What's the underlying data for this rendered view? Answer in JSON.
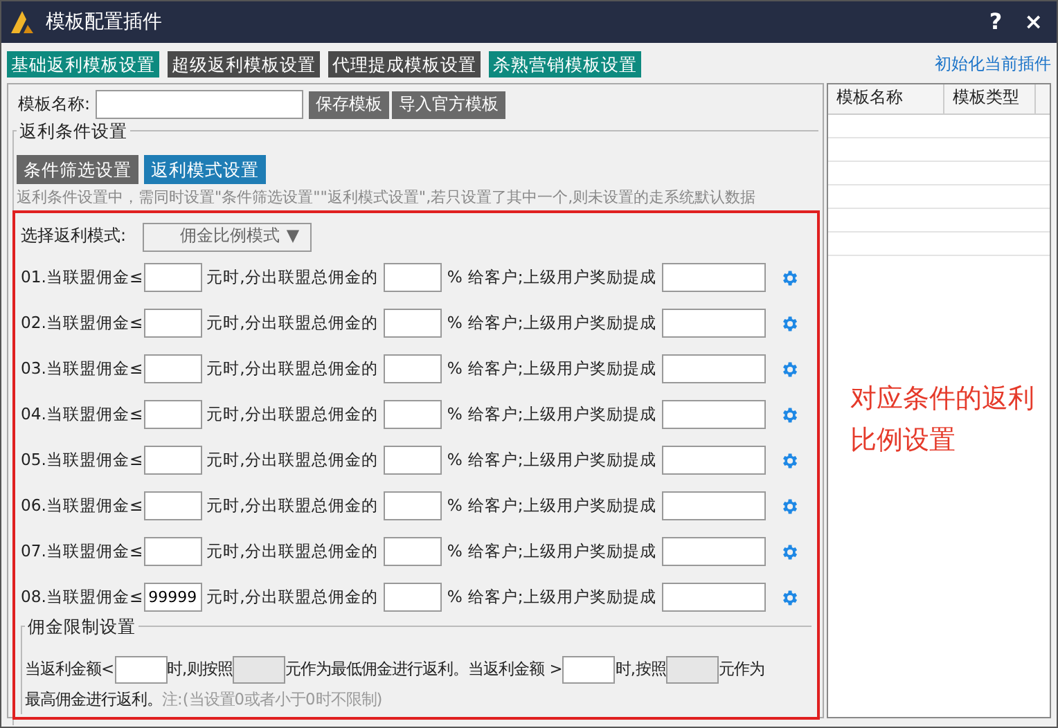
{
  "window": {
    "title": "模板配置插件",
    "help": "?",
    "close": "×"
  },
  "toolbar": {
    "buttons": [
      {
        "label": "基础返利模板设置",
        "color": "#0e8a7f"
      },
      {
        "label": "超级返利模板设置",
        "color": "#4a4a4a"
      },
      {
        "label": "代理提成模板设置",
        "color": "#4a4a4a"
      },
      {
        "label": "杀熟营销模板设置",
        "color": "#0e8a7f"
      }
    ],
    "link": "初始化当前插件"
  },
  "template_name": {
    "label": "模板名称:",
    "save": "保存模板",
    "import": "导入官方模板"
  },
  "rebate_section": {
    "legend": "返利条件设置",
    "tabs": [
      {
        "label": "条件筛选设置",
        "selected": false
      },
      {
        "label": "返利模式设置",
        "selected": true
      }
    ],
    "note": "返利条件设置中，需同时设置\"条件筛选设置\"\"返利模式设置\",若只设置了其中一个,则未设置的走系统默认数据",
    "mode": {
      "label": "选择返利模式:",
      "value": "佣金比例模式",
      "arrow": "▼"
    },
    "rows": [
      {
        "prefix": "01.当联盟佣金≤",
        "mid": "元时,分出联盟总佣金的",
        "unit": "%",
        "tail": "给客户;上级用户奖励提成"
      },
      {
        "prefix": "02.当联盟佣金≤",
        "mid": "元时,分出联盟总佣金的",
        "unit": "%",
        "tail": "给客户;上级用户奖励提成"
      },
      {
        "prefix": "03.当联盟佣金≤",
        "mid": "元时,分出联盟总佣金的",
        "unit": "%",
        "tail": "给客户;上级用户奖励提成"
      },
      {
        "prefix": "04.当联盟佣金≤",
        "mid": "元时,分出联盟总佣金的",
        "unit": "%",
        "tail": "给客户;上级用户奖励提成"
      },
      {
        "prefix": "05.当联盟佣金≤",
        "mid": "元时,分出联盟总佣金的",
        "unit": "%",
        "tail": "给客户;上级用户奖励提成"
      },
      {
        "prefix": "06.当联盟佣金≤",
        "mid": "元时,分出联盟总佣金的",
        "unit": "%",
        "tail": "给客户;上级用户奖励提成"
      },
      {
        "prefix": "07.当联盟佣金≤",
        "mid": "元时,分出联盟总佣金的",
        "unit": "%",
        "tail": "给客户;上级用户奖励提成"
      },
      {
        "prefix": "08.当联盟佣金≤",
        "threshold": "99999",
        "mid": "元时,分出联盟总佣金的",
        "unit": "%",
        "tail": "给客户;上级用户奖励提成"
      }
    ],
    "limit": {
      "legend": "佣金限制设置",
      "parts": [
        {
          "kind": "text",
          "text": "当返利金额<"
        },
        {
          "kind": "field",
          "disabled": false
        },
        {
          "kind": "text",
          "text": "时,则按照"
        },
        {
          "kind": "field",
          "disabled": true
        },
        {
          "kind": "text",
          "text": "元作为最低佣金进行返利。当返利金额 >"
        },
        {
          "kind": "field",
          "disabled": false
        },
        {
          "kind": "text",
          "text": "时,按照"
        },
        {
          "kind": "field",
          "disabled": true
        },
        {
          "kind": "text",
          "text": "元作为"
        },
        {
          "kind": "text",
          "text": "最高佣金进行返利。"
        },
        {
          "kind": "note",
          "text": "注:(当设置0或者小于0时不限制)"
        }
      ]
    }
  },
  "annotation": "对应条件的返利比例设置",
  "template_table": {
    "columns": [
      "模板名称",
      "模板类型"
    ]
  }
}
